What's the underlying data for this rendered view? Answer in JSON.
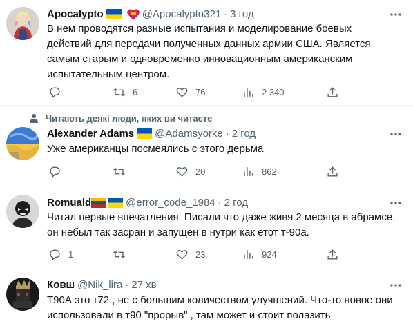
{
  "tweets": [
    {
      "name": "Apocalypto",
      "handle": "@Apocalypto321",
      "separator": "·",
      "time": "3 год",
      "lines": [
        "В нем проводятся разные испытания и моделирование боевых",
        "действий для передачи полученных данных армии США. Является",
        "самым старым и одновременно инновационным американским",
        "испытательным центром."
      ],
      "replies": "",
      "retweets": "6",
      "likes": "76",
      "views": "2 340"
    },
    {
      "social_context": "Читають деякі люди, яких ви читаєте",
      "name": "Alexander Adams",
      "handle": "@Adamsyorke",
      "separator": "·",
      "time": "2 год",
      "lines": [
        "Уже американцы посмеялись с этого дерьма"
      ],
      "replies": "",
      "retweets": "",
      "likes": "20",
      "views": "862"
    },
    {
      "name": "Romuald",
      "handle": "@error_code_1984",
      "separator": "·",
      "time": "2 год",
      "lines": [
        "Читал первые впечатления. Писали что даже живя 2 месяца в абрамсе,",
        "он небыл так засран и запущен в нутри как етот т-90а."
      ],
      "replies": "1",
      "retweets": "",
      "likes": "23",
      "views": "924"
    },
    {
      "name": "Ковш",
      "handle": "@Nik_lira",
      "separator": "·",
      "time": "27 хв",
      "lines": [
        "Т90А это т72 , не с большим количеством улучшений. Что-то новое они",
        "использовали в т90 \"прорыв\" , там может и стоит полазить"
      ]
    }
  ],
  "colors": {
    "text": "#0f1419",
    "muted": "#536471",
    "divider": "#eff3f4",
    "flag_blue": "#0057b7",
    "flag_yellow": "#ffd700"
  },
  "icons": [
    "more-icon",
    "reply-icon",
    "retweet-icon",
    "like-icon",
    "views-icon",
    "share-icon",
    "heart-icon"
  ]
}
